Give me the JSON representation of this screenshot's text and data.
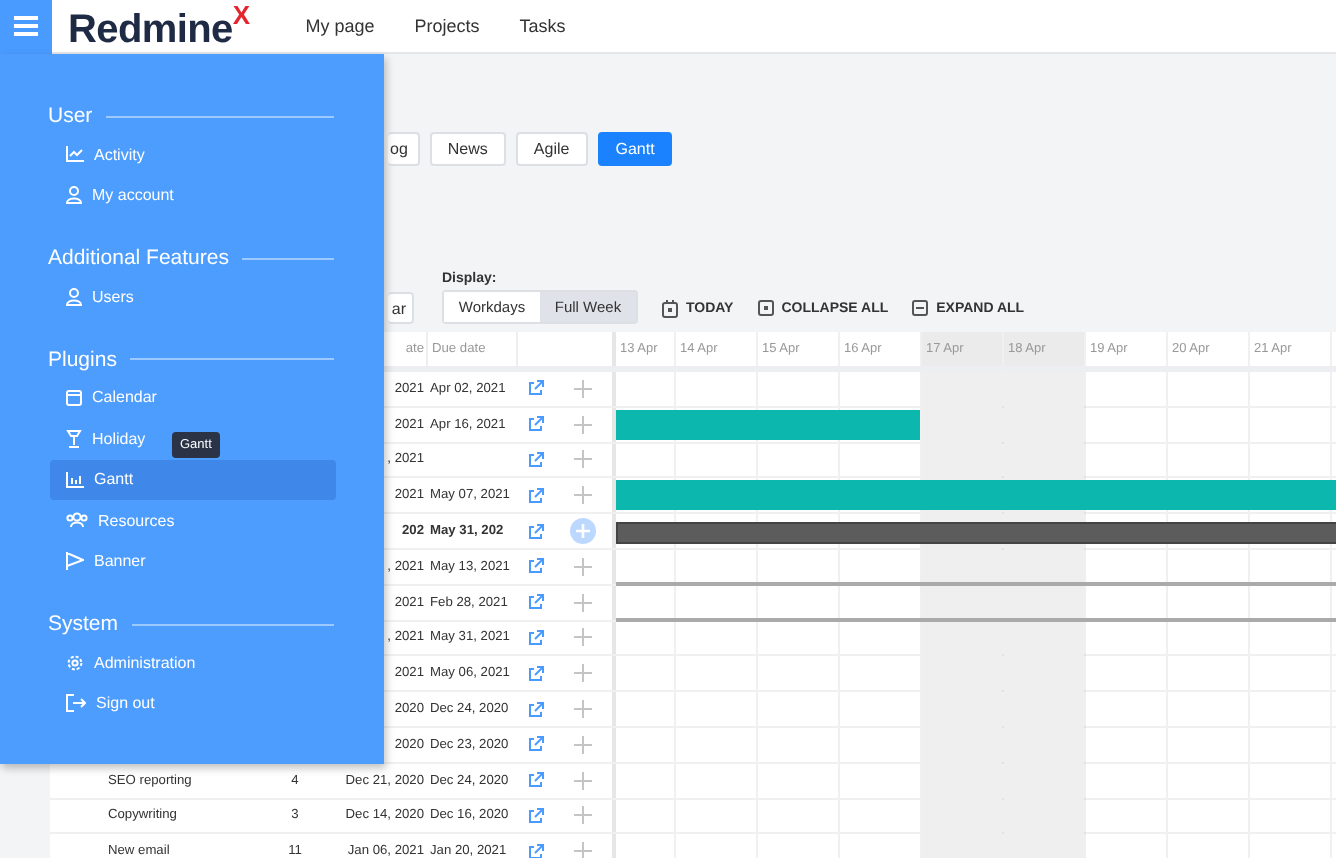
{
  "top_bar": {
    "logo": "Redmine",
    "logo_mark": "X",
    "nav": [
      "My page",
      "Projects",
      "Tasks"
    ]
  },
  "sidebar": {
    "sections": [
      {
        "title": "User",
        "items": [
          {
            "label": "Activity",
            "kind": "chart",
            "selected": false
          },
          {
            "label": "My account",
            "kind": "person",
            "selected": false
          }
        ]
      },
      {
        "title": "Additional Features",
        "items": [
          {
            "label": "Users",
            "kind": "person",
            "selected": false
          }
        ]
      },
      {
        "title": "Plugins",
        "items": [
          {
            "label": "Calendar",
            "kind": "calendar",
            "selected": false
          },
          {
            "label": "Holiday",
            "kind": "holiday",
            "selected": false
          },
          {
            "label": "Gantt",
            "kind": "bars",
            "selected": true
          },
          {
            "label": "Resources",
            "kind": "people",
            "selected": false
          },
          {
            "label": "Banner",
            "kind": "flag",
            "selected": false
          }
        ]
      },
      {
        "title": "System",
        "items": [
          {
            "label": "Administration",
            "kind": "gear",
            "selected": false
          },
          {
            "label": "Sign out",
            "kind": "signout",
            "selected": false
          }
        ]
      }
    ],
    "tooltip": "Gantt"
  },
  "tabs": [
    {
      "label": "og",
      "selected": false
    },
    {
      "label": "News",
      "selected": false
    },
    {
      "label": "Agile",
      "selected": false
    },
    {
      "label": "Gantt",
      "selected": true
    }
  ],
  "toolbar": {
    "partial_button": "ar",
    "display_label": "Display:",
    "display_options": [
      {
        "label": "Workdays",
        "selected": false
      },
      {
        "label": "Full Week",
        "selected": true
      }
    ],
    "actions": [
      {
        "label": "TODAY",
        "kind": "today"
      },
      {
        "label": "COLLAPSE ALL",
        "kind": "collapse"
      },
      {
        "label": "EXPAND ALL",
        "kind": "expand"
      }
    ]
  },
  "table": {
    "columns": [
      "ate",
      "Due date"
    ],
    "days": [
      {
        "label": "13 Apr",
        "weekend": false
      },
      {
        "label": "14 Apr",
        "weekend": false
      },
      {
        "label": "15 Apr",
        "weekend": false
      },
      {
        "label": "16 Apr",
        "weekend": false
      },
      {
        "label": "17 Apr",
        "weekend": true
      },
      {
        "label": "18 Apr",
        "weekend": true
      },
      {
        "label": "19 Apr",
        "weekend": false
      },
      {
        "label": "20 Apr",
        "weekend": false
      },
      {
        "label": "21 Apr",
        "weekend": false
      }
    ],
    "rows": [
      {
        "kind": "issue",
        "start": "2021",
        "due": "Apr 02, 2021"
      },
      {
        "kind": "issue",
        "start": "2021",
        "due": "Apr 16, 2021",
        "bar": {
          "kind": "task",
          "level": 0.42
        }
      },
      {
        "kind": "issue",
        "start": ", 2021"
      },
      {
        "kind": "issue",
        "start": "2021",
        "due": "May 07, 2021",
        "bar": {
          "kind": "task",
          "level": 1
        }
      },
      {
        "kind": "project",
        "start": "202",
        "due": "May 31, 202",
        "bar": {
          "kind": "project",
          "level": 1
        }
      },
      {
        "kind": "issue",
        "start": ", 2021",
        "due": "May 13, 2021",
        "bar": {
          "kind": "line",
          "level": 1
        }
      },
      {
        "kind": "issue",
        "start": "2021",
        "due": "Feb 28, 2021",
        "bar": {
          "kind": "line",
          "level": 1
        }
      },
      {
        "kind": "issue",
        "start": ", 2021",
        "due": "May 31, 2021"
      },
      {
        "kind": "issue",
        "start": "2021",
        "due": "May 06, 2021"
      },
      {
        "kind": "issue",
        "start": "2020",
        "due": "Dec 24, 2020"
      },
      {
        "kind": "issue",
        "start": "2020",
        "due": "Dec 23, 2020"
      },
      {
        "kind": "issue",
        "subject": "SEO reporting",
        "count": "4",
        "start": "Dec 21, 2020",
        "due": "Dec 24, 2020"
      },
      {
        "kind": "issue",
        "subject": "Copywriting",
        "count": "3",
        "start": "Dec 14, 2020",
        "due": "Dec 16, 2020"
      },
      {
        "kind": "issue",
        "subject": "New email",
        "count": "11",
        "start": "Jan 06, 2021",
        "due": "Jan 20, 2021"
      }
    ]
  }
}
